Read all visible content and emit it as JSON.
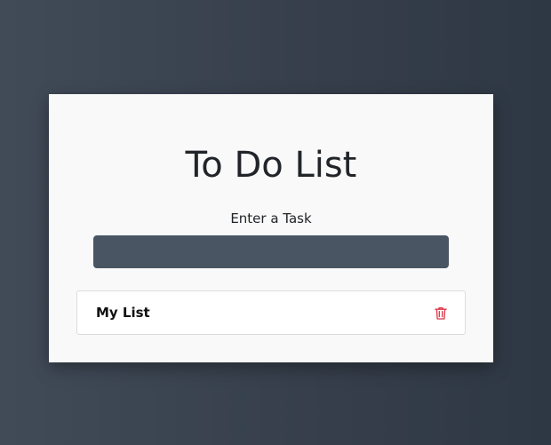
{
  "app": {
    "title": "To Do List"
  },
  "form": {
    "label": "Enter a Task",
    "input_value": "",
    "input_placeholder": ""
  },
  "list": {
    "items": [
      {
        "label": "My List",
        "action_icon": "trash-icon"
      }
    ]
  },
  "colors": {
    "background_left": "#414b58",
    "background_right": "#2e3844",
    "card": "#f9f9f9",
    "input": "#495562",
    "delete_icon": "#dc3545",
    "text": "#212529"
  }
}
